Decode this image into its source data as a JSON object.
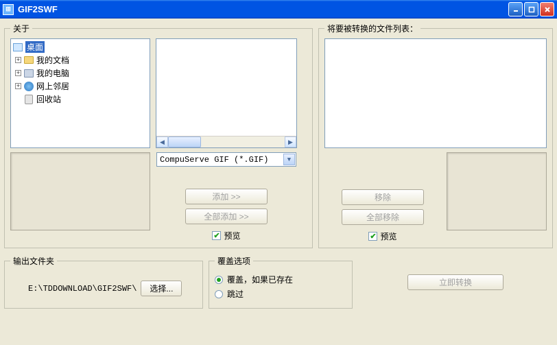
{
  "window": {
    "title": "GIF2SWF"
  },
  "left_group": {
    "legend": "关于"
  },
  "tree": {
    "items": [
      {
        "label": "桌面",
        "selected": true,
        "expandable": false,
        "indent": 0,
        "icon": "desktop"
      },
      {
        "label": "我的文档",
        "selected": false,
        "expandable": true,
        "indent": 1,
        "icon": "folder"
      },
      {
        "label": "我的电脑",
        "selected": false,
        "expandable": true,
        "indent": 1,
        "icon": "computer"
      },
      {
        "label": "网上邻居",
        "selected": false,
        "expandable": true,
        "indent": 1,
        "icon": "globe"
      },
      {
        "label": "回收站",
        "selected": false,
        "expandable": false,
        "indent": 1,
        "icon": "bin"
      }
    ]
  },
  "filter": {
    "selected": "CompuServe GIF (*.GIF)"
  },
  "buttons": {
    "add": "添加 >>",
    "add_all": "全部添加 >>",
    "remove": "移除",
    "remove_all": "全部移除",
    "convert": "立即转换",
    "browse": "选择..."
  },
  "checkboxes": {
    "preview_left": {
      "label": "预览",
      "checked": true
    },
    "preview_right": {
      "label": "预览",
      "checked": true
    }
  },
  "right_group": {
    "legend": "将要被转换的文件列表："
  },
  "output": {
    "legend": "输出文件夹",
    "path": "E:\\TDDOWNLOAD\\GIF2SWF\\"
  },
  "overwrite": {
    "legend": "覆盖选项",
    "opt_overwrite": "覆盖，如果已存在",
    "opt_skip": "跳过",
    "selected": "overwrite"
  }
}
